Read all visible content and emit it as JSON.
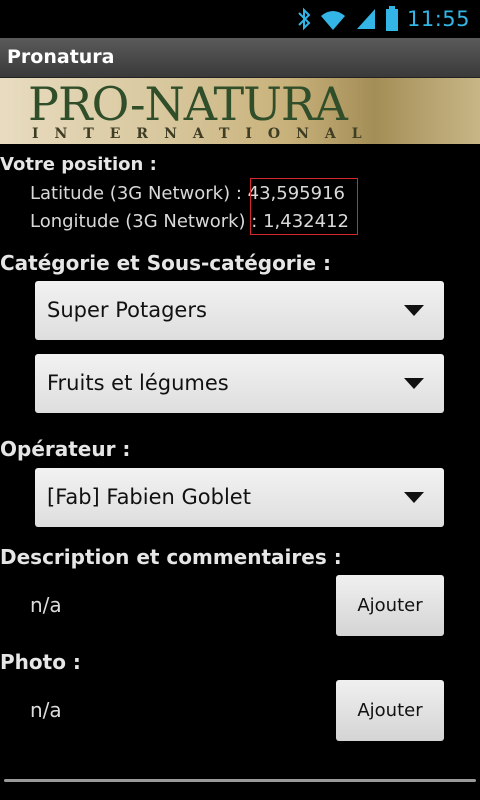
{
  "status": {
    "time": "11:55",
    "icons": [
      "bluetooth-icon",
      "wifi-icon",
      "signal-icon",
      "battery-icon"
    ]
  },
  "app": {
    "title": "Pronatura"
  },
  "banner": {
    "brand": "PRO-NATURA",
    "subtitle": "INTERNATIONAL"
  },
  "position": {
    "title": "Votre position :",
    "latitude_label": "Latitude (3G Network) : ",
    "latitude_value": "43,595916",
    "longitude_label": "Longitude (3G Network) : ",
    "longitude_value": "1,432412"
  },
  "category": {
    "title": "Catégorie et Sous-catégorie :",
    "category_value": "Super Potagers",
    "subcategory_value": "Fruits et légumes"
  },
  "operator": {
    "title": "Opérateur :",
    "value": "[Fab] Fabien Goblet"
  },
  "description": {
    "title": "Description et commentaires :",
    "value": "n/a",
    "button": "Ajouter"
  },
  "photo": {
    "title": "Photo :",
    "value": "n/a",
    "button": "Ajouter"
  },
  "colors": {
    "accent": "#33b5e5",
    "highlight_border": "#d62828"
  }
}
